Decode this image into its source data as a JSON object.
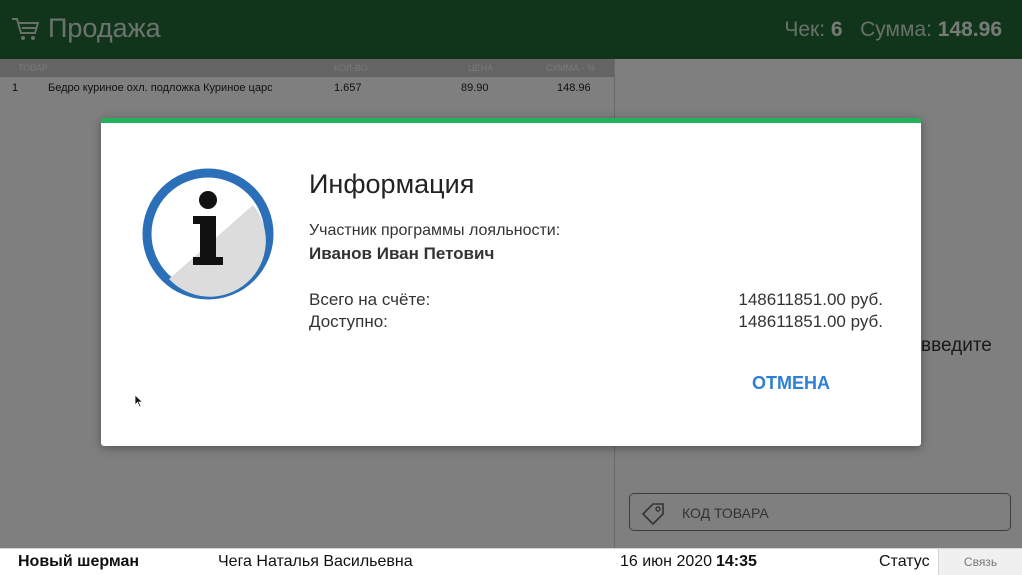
{
  "header": {
    "cart_icon": "cart-icon",
    "title": "Продажа",
    "receipt_label": "Чек:",
    "receipt_number": "6",
    "sum_label": "Сумма:",
    "sum_value": "148.96"
  },
  "table": {
    "columns": [
      "ТОВАР",
      "КОЛ-ВО",
      "ЦЕНА",
      "СУММА - %"
    ],
    "rows": [
      {
        "num": "1",
        "name": "Бедро куриное охл. подложка Куриное царс",
        "qty": "1.657",
        "price": "89.90",
        "sum": "148.96"
      }
    ]
  },
  "right": {
    "hint_partial": "введите",
    "code_placeholder": "КОД ТОВАРА",
    "tag_icon": "tag-icon"
  },
  "statusbar": {
    "store": "Новый шерман",
    "cashier": "Чега Наталья Васильевна",
    "date": "16 июн 2020",
    "time": "14:35",
    "status": "Статус",
    "link": "Связь"
  },
  "dialog": {
    "icon": "info-icon",
    "title": "Информация",
    "loyalty_label": "Участник программы лояльности:",
    "member_name": "Иванов Иван Петович",
    "total_label": "Всего на счёте:",
    "total_value": "148611851.00 руб.",
    "available_label": "Доступно:",
    "available_value": "148611851.00 руб.",
    "cancel_label": "ОТМЕНА"
  },
  "colors": {
    "header_bg": "#236a37",
    "dialog_accent": "#22b35a",
    "button_text": "#2e7fd6",
    "info_ring": "#2a6fb8"
  }
}
